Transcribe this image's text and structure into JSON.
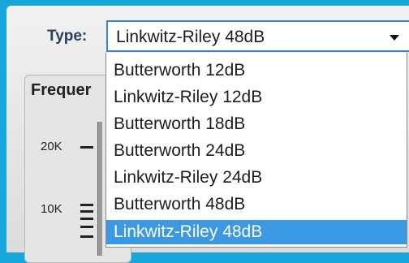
{
  "filter": {
    "label": "Type:",
    "selected_value": "Linkwitz-Riley 48dB",
    "options": [
      "Butterworth 12dB",
      "Linkwitz-Riley 12dB",
      "Butterworth 18dB",
      "Butterworth 24dB",
      "Linkwitz-Riley 24dB",
      "Butterworth 48dB",
      "Linkwitz-Riley 48dB"
    ],
    "highlighted_option": "Linkwitz-Riley 48dB"
  },
  "frequency_panel": {
    "heading": "Frequer",
    "ticks": [
      "20K",
      "10K"
    ]
  },
  "colors": {
    "frame": "#16a6d9",
    "highlight": "#3b99e4",
    "select_border": "#3a83c9"
  }
}
